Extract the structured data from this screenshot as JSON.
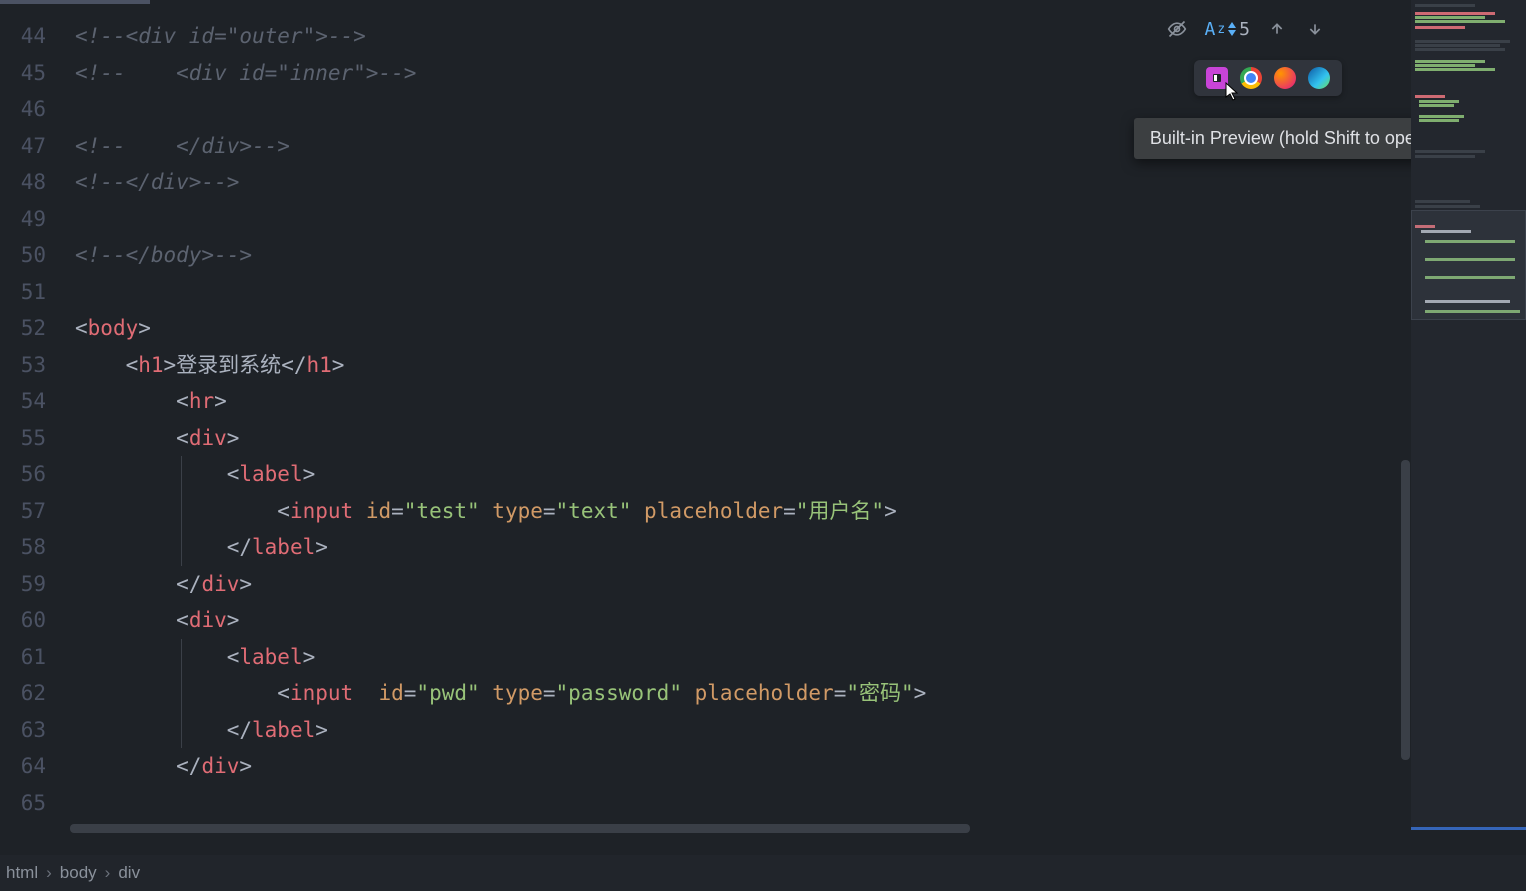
{
  "gutter": {
    "lines": [
      "44",
      "45",
      "46",
      "47",
      "48",
      "49",
      "50",
      "51",
      "52",
      "53",
      "54",
      "55",
      "56",
      "57",
      "58",
      "59",
      "60",
      "61",
      "62",
      "63",
      "64",
      "65"
    ]
  },
  "code": {
    "l44": "<!--<div id=\"outer\">-->",
    "l45": "<!--    <div id=\"inner\">-->",
    "l46": "",
    "l47": "<!--    </div>-->",
    "l48": "<!--</div>-->",
    "l49": "",
    "l50": "<!--</body>-->",
    "l51": "",
    "l52_open": "<",
    "l52_tag": "body",
    "l52_close": ">",
    "l53_open": "<",
    "l53_tag": "h1",
    "l53_mid": ">",
    "l53_text": "登录到系统",
    "l53_end_open": "</",
    "l53_end_tag": "h1",
    "l53_end_close": ">",
    "l54_open": "<",
    "l54_tag": "hr",
    "l54_close": ">",
    "l55_open": "<",
    "l55_tag": "div",
    "l55_close": ">",
    "l56_open": "<",
    "l56_tag": "label",
    "l56_close": ">",
    "l57_open": "<",
    "l57_tag": "input",
    "l57_sp1": " ",
    "l57_attr1": "id",
    "l57_eq1": "=",
    "l57_val1": "\"test\"",
    "l57_sp2": " ",
    "l57_attr2": "type",
    "l57_eq2": "=",
    "l57_val2": "\"text\"",
    "l57_sp3": " ",
    "l57_attr3": "placeholder",
    "l57_eq3": "=",
    "l57_val3": "\"用户名\"",
    "l57_close": ">",
    "l58_open": "</",
    "l58_tag": "label",
    "l58_close": ">",
    "l59_open": "</",
    "l59_tag": "div",
    "l59_close": ">",
    "l60_open": "<",
    "l60_tag": "div",
    "l60_close": ">",
    "l61_open": "<",
    "l61_tag": "label",
    "l61_close": ">",
    "l62_open": "<",
    "l62_tag": "input",
    "l62_sp1": "  ",
    "l62_attr1": "id",
    "l62_eq1": "=",
    "l62_val1": "\"pwd\"",
    "l62_sp2": " ",
    "l62_attr2": "type",
    "l62_eq2": "=",
    "l62_val2": "\"password\"",
    "l62_sp3": " ",
    "l62_attr3": "placeholder",
    "l62_eq3": "=",
    "l62_val3": "\"密码\"",
    "l62_close": ">",
    "l63_open": "</",
    "l63_tag": "label",
    "l63_close": ">",
    "l64_open": "</",
    "l64_tag": "div",
    "l64_close": ">",
    "l65": ""
  },
  "toolbar": {
    "az_prefix": "A",
    "az_z": "z",
    "font_count": "5"
  },
  "tooltip": {
    "text": "Built-in Preview (hold Shift to open a local file"
  },
  "breadcrumb": {
    "seg1": "html",
    "seg2": "body",
    "seg3": "div",
    "sep": "›"
  }
}
